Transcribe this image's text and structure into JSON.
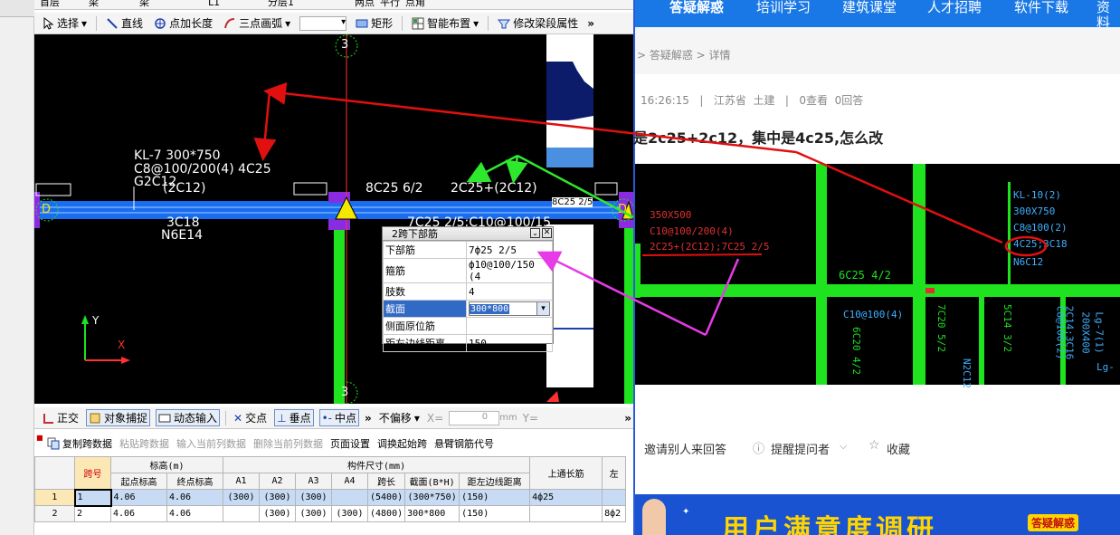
{
  "app": {
    "top_fields": [
      "首层",
      "梁",
      "梁",
      "L1",
      "分层1"
    ],
    "top_tools": [
      "两点",
      "平行",
      "点角"
    ],
    "draw_toolbar": {
      "select": "选择",
      "line": "直线",
      "point_length": "点加长度",
      "arc": "三点画弧",
      "rect": "矩形",
      "smart_layout": "智能布置",
      "edit_span": "修改梁段属性"
    },
    "drawing": {
      "axis_top": "3",
      "axis_bottom": "3",
      "axis_left": "D",
      "axis_right": "D",
      "beam_label_line1": "KL-7 300*750",
      "beam_label_line2": "C8@100/200(4) 4C25",
      "beam_label_line3": "G2C12",
      "beam_label_line4": "(2C12)",
      "top_mid": "8C25 6/2",
      "top_right": "2C25+(2C12)",
      "bottom_left1": "3C18",
      "bottom_left2": "N6E14",
      "bottom_right": "7C25 2/5;C10@100/15",
      "edge_label": "8C25 2/5",
      "coord_y": "Y",
      "coord_x": "X"
    },
    "prop_window": {
      "title": "2跨下部筋",
      "rows": [
        {
          "key": "下部筋",
          "value": "7ф25 2/5"
        },
        {
          "key": "箍筋",
          "value": "ф10@100/150 (4"
        },
        {
          "key": "肢数",
          "value": "4"
        },
        {
          "key": "截面",
          "value": "300*800"
        },
        {
          "key": "侧面原位筋",
          "value": ""
        },
        {
          "key": "距左边线距离",
          "value": "150"
        }
      ]
    },
    "status_bar": {
      "ortho": "正交",
      "snap": "对象捕捉",
      "dynamic": "动态输入",
      "intersection": "交点",
      "perp": "垂点",
      "midpoint": "中点",
      "no_offset": "不偏移",
      "x_label": "X=",
      "x_value": "0",
      "unit": "mm",
      "y_label": "Y="
    },
    "grid_toolbar": {
      "copy": "复制跨数据",
      "paste": "粘贴跨数据",
      "input_col": "输入当前列数据",
      "delete_col": "删除当前列数据",
      "page_setup": "页面设置",
      "swap_start": "调换起始跨",
      "cantilever": "悬臂钢筋代号"
    },
    "grid": {
      "h_span": "跨号",
      "h_elev": "标高(m)",
      "h_size": "构件尺寸(mm)",
      "h_top": "上通长筋",
      "h_left": "左",
      "sub": [
        "起点标高",
        "终点标高",
        "A1",
        "A2",
        "A3",
        "A4",
        "跨长",
        "截面(B*H)",
        "距左边线距离"
      ],
      "rows": [
        [
          "1",
          "1",
          "4.06",
          "4.06",
          "(300)",
          "(300)",
          "(300)",
          "",
          "(5400)",
          "(300*750)",
          "(150)",
          "4ф25",
          ""
        ],
        [
          "2",
          "2",
          "4.06",
          "4.06",
          "",
          "(300)",
          "(300)",
          "(300)",
          "(4800)",
          "300*800",
          "(150)",
          "",
          "8ф2"
        ]
      ]
    }
  },
  "web": {
    "nav": [
      "答疑解惑",
      "培训学习",
      "建筑课堂",
      "人才招聘",
      "软件下载",
      "资料"
    ],
    "breadcrumb": "> 答疑解惑 > 详情",
    "meta": "16:26:15   |   江苏省  土建   |   0查看  0回答",
    "question": "是2c25+2c12，集中是4c25,怎么改",
    "photo_labels": {
      "l1": "350X500",
      "l2": "C10@100/200(4)",
      "l3": "2C25+(2C12);7C25 2/5",
      "mid": "6C25 4/2",
      "r1": "KL-10(2)",
      "r2": "300X750",
      "r3": "C8@100(2)",
      "r4": "4C25;3C18",
      "r5": "N6C12",
      "b1": "C10@100(4)",
      "b2": "6C20 4/2",
      "b3": "7C20 5/2",
      "b4": "5C14 3/2",
      "b5": "C8@100(2)",
      "b6": "2C14;3C16",
      "b7": "200X400",
      "b8": "Lg-7(1)",
      "b9": "N2C12",
      "b10": "Lg-"
    },
    "actions": {
      "invite": "邀请别人来回答",
      "remind": "提醒提问者",
      "fav": "收藏"
    },
    "banner": "用户满意度调研",
    "banner_tag": "答疑解惑"
  },
  "colors": {
    "nav_blue": "#1a78e6",
    "beam_blue": "#1a6cf0",
    "green": "#1ee31e",
    "arrow_red": "#e01010",
    "arrow_green": "#2ee82e",
    "arrow_magenta": "#e63be6"
  }
}
